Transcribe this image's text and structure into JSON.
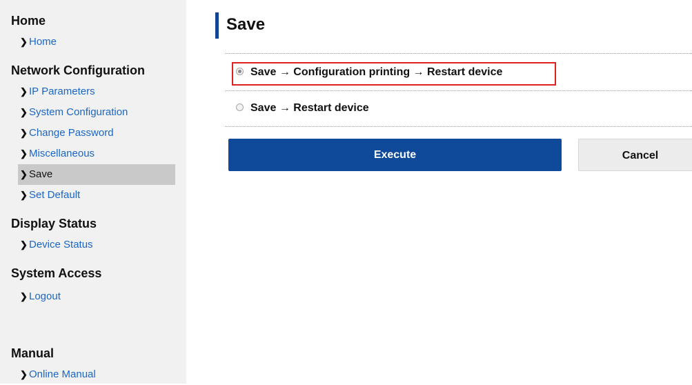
{
  "sidebar": {
    "sections": [
      {
        "title": "Home",
        "items": [
          {
            "label": "Home"
          }
        ]
      },
      {
        "title": "Network Configuration",
        "items": [
          {
            "label": "IP Parameters"
          },
          {
            "label": "System Configuration"
          },
          {
            "label": "Change Password"
          },
          {
            "label": "Miscellaneous"
          },
          {
            "label": "Save",
            "active": true
          },
          {
            "label": "Set Default"
          }
        ]
      },
      {
        "title": "Display Status",
        "items": [
          {
            "label": "Device Status"
          }
        ]
      },
      {
        "title": "System Access",
        "items": [
          {
            "label": "Logout"
          }
        ]
      },
      {
        "title": "Manual",
        "items": [
          {
            "label": "Online Manual"
          }
        ]
      }
    ],
    "chevron_icon": "chevron-right-icon"
  },
  "main": {
    "title": "Save",
    "options": [
      {
        "label": "Save → Configuration printing → Restart device",
        "selected": true
      },
      {
        "label": "Save → Restart device",
        "selected": false
      }
    ],
    "execute_label": "Execute",
    "cancel_label": "Cancel"
  },
  "colors": {
    "accent": "#11458f",
    "execute_button": "#0e4a99",
    "link": "#1a66c4",
    "highlight_box": "#e0201f",
    "sidebar_bg": "#f1f1f1",
    "active_item_bg": "#c9c9c9"
  }
}
